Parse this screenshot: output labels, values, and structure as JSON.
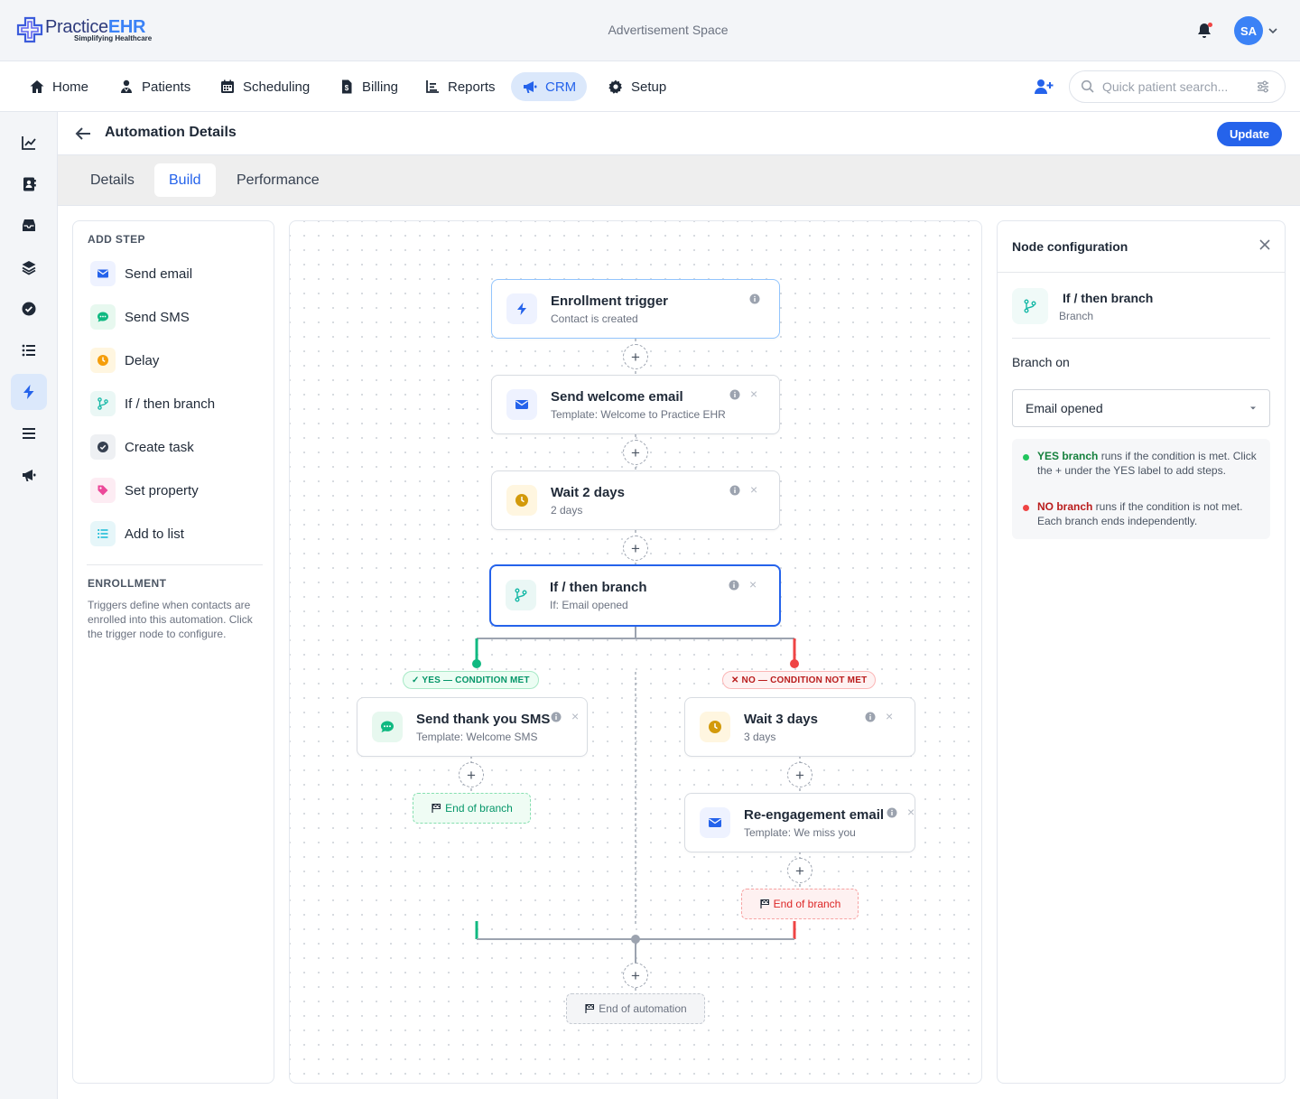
{
  "header": {
    "logo_main": "Practice",
    "logo_accent": "EHR",
    "logo_tagline": "Simplifying Healthcare",
    "ad_text": "Advertisement Space",
    "avatar_initials": "SA"
  },
  "nav": {
    "items": [
      {
        "label": "Home",
        "icon": "home-icon"
      },
      {
        "label": "Patients",
        "icon": "patients-icon"
      },
      {
        "label": "Scheduling",
        "icon": "calendar-icon"
      },
      {
        "label": "Billing",
        "icon": "billing-icon"
      },
      {
        "label": "Reports",
        "icon": "reports-icon"
      },
      {
        "label": "CRM",
        "icon": "megaphone-icon",
        "active": true
      },
      {
        "label": "Setup",
        "icon": "gear-icon"
      }
    ],
    "search_placeholder": "Quick patient search..."
  },
  "sidebar": {
    "icons": [
      "chart-line-icon",
      "contact-book-icon",
      "inbox-icon",
      "layers-icon",
      "check-circle-icon",
      "list-icon",
      "bolt-icon",
      "menu-icon",
      "megaphone-icon"
    ],
    "active_index": 6
  },
  "page": {
    "title": "Automation Details",
    "update_label": "Update",
    "tabs": [
      {
        "label": "Details"
      },
      {
        "label": "Build",
        "active": true
      },
      {
        "label": "Performance"
      }
    ]
  },
  "add_step": {
    "heading": "ADD STEP",
    "items": [
      {
        "label": "Send email",
        "icon": "email-icon"
      },
      {
        "label": "Send SMS",
        "icon": "sms-icon"
      },
      {
        "label": "Delay",
        "icon": "clock-icon"
      },
      {
        "label": "If / then branch",
        "icon": "branch-icon"
      },
      {
        "label": "Create task",
        "icon": "task-icon"
      },
      {
        "label": "Set property",
        "icon": "tag-icon"
      },
      {
        "label": "Add to list",
        "icon": "list-icon"
      }
    ]
  },
  "enrollment": {
    "heading": "ENROLLMENT",
    "text": "Triggers define when contacts are enrolled into this automation. Click the trigger node to configure."
  },
  "flow": {
    "trigger": {
      "title": "Enrollment trigger",
      "sub": "Contact is created"
    },
    "welcome": {
      "title": "Send welcome email",
      "sub": "Template: Welcome to Practice EHR"
    },
    "wait2": {
      "title": "Wait 2 days",
      "sub": "2 days"
    },
    "branch": {
      "title": "If / then branch",
      "sub": "If: Email opened"
    },
    "yes_label": "✓ YES — CONDITION MET",
    "no_label": "✕ NO — CONDITION NOT MET",
    "yes_sms": {
      "title": "Send thank you SMS",
      "sub": "Template: Welcome SMS"
    },
    "no_wait3": {
      "title": "Wait 3 days",
      "sub": "3 days"
    },
    "no_reengage": {
      "title": "Re-engagement email",
      "sub": "Template: We miss you"
    },
    "end_branch": "End of branch",
    "end_automation": "End of automation",
    "plus": "+",
    "close": "×"
  },
  "config": {
    "title": "Node configuration",
    "node_title": "If / then branch",
    "node_sub": "Branch",
    "branch_on_label": "Branch on",
    "branch_on_value": "Email opened",
    "yes_strong": "YES branch",
    "yes_text": " runs if the condition is met. Click the + under the YES label to add steps.",
    "no_strong": "NO branch",
    "no_text": " runs if the condition is not met. Each branch ends independently."
  },
  "colors": {
    "primary": "#2563eb",
    "yes": "#10b981",
    "no": "#ef4444"
  }
}
